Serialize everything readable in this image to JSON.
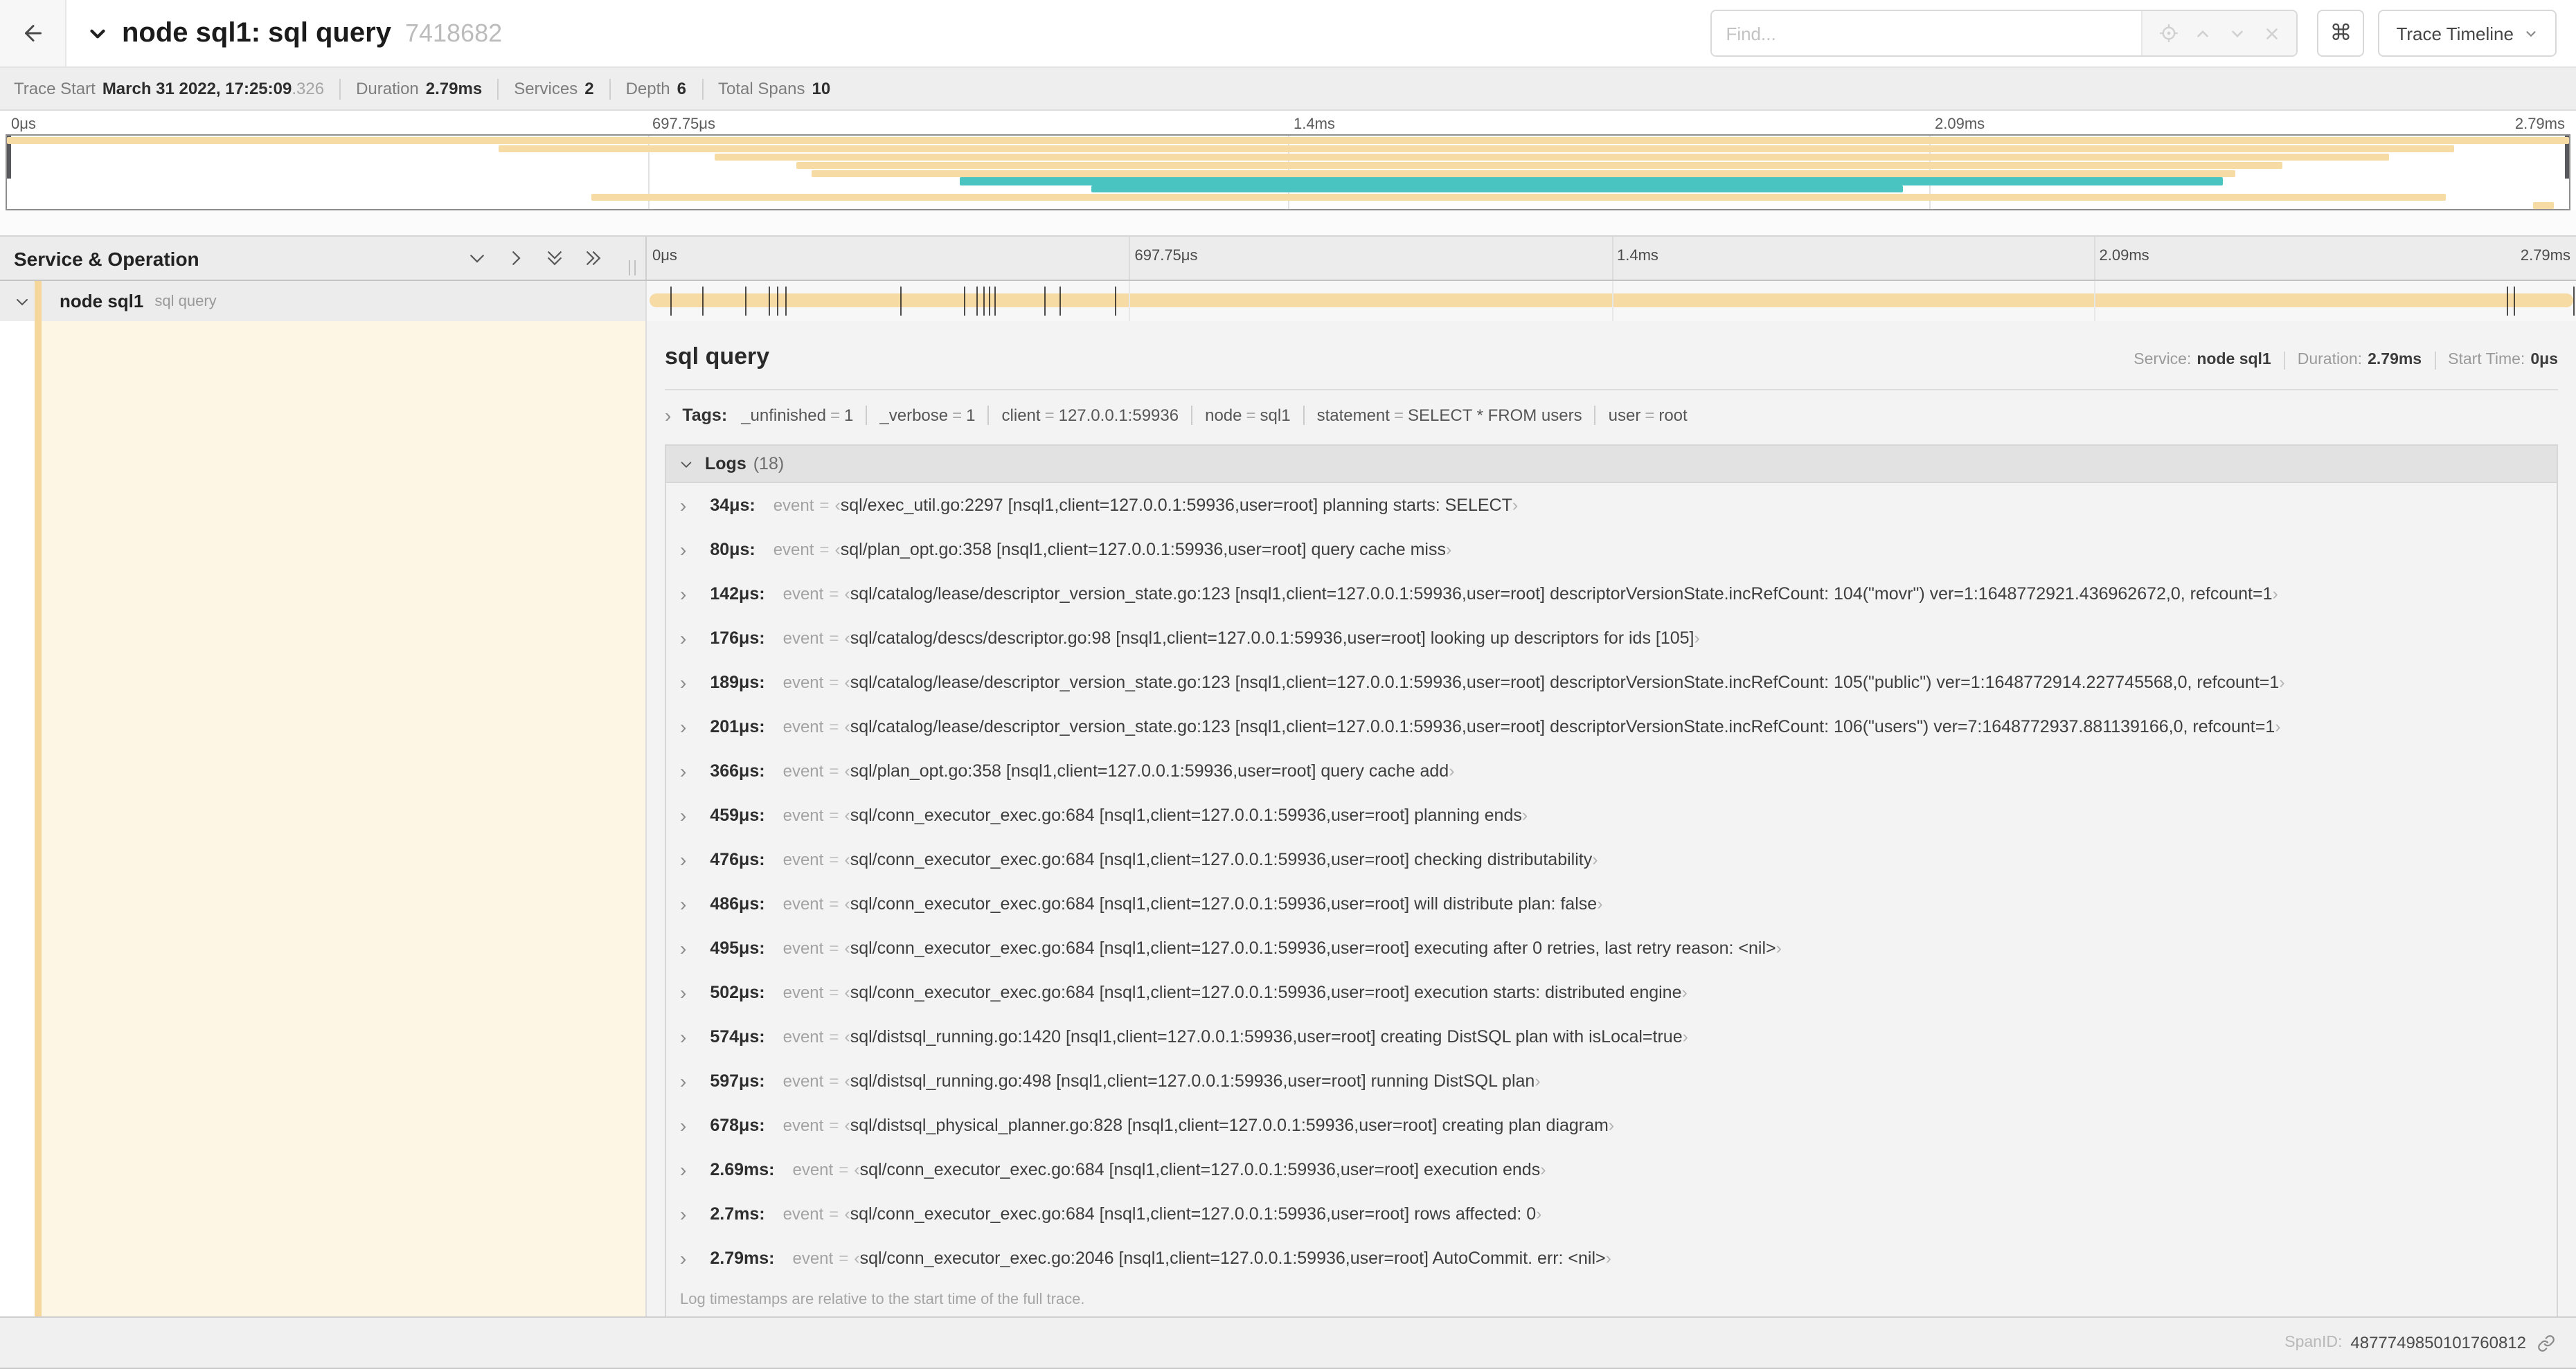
{
  "header": {
    "title": "node sql1: sql query",
    "trace_id": "7418682",
    "find_placeholder": "Find...",
    "shortcut_label": "⌘",
    "view_dropdown": "Trace Timeline"
  },
  "summary": {
    "trace_start_label": "Trace Start",
    "trace_start": "March 31 2022, 17:25:09",
    "trace_start_fraction": ".326",
    "duration_label": "Duration",
    "duration": "2.79ms",
    "services_label": "Services",
    "services": "2",
    "depth_label": "Depth",
    "depth": "6",
    "total_spans_label": "Total Spans",
    "total_spans": "10"
  },
  "timeline": {
    "service_operation_label": "Service & Operation",
    "ticks": [
      {
        "label": "0μs",
        "pct": 0
      },
      {
        "label": "697.75μs",
        "pct": 25
      },
      {
        "label": "1.4ms",
        "pct": 50
      },
      {
        "label": "2.09ms",
        "pct": 75
      },
      {
        "label": "2.79ms",
        "pct": 100
      }
    ]
  },
  "minimap": {
    "spans": [
      {
        "start": 0.0,
        "end": 1.0,
        "color": "tan"
      },
      {
        "start": 0.192,
        "end": 0.955,
        "color": "tan"
      },
      {
        "start": 0.276,
        "end": 0.93,
        "color": "tan"
      },
      {
        "start": 0.308,
        "end": 0.888,
        "color": "tan"
      },
      {
        "start": 0.314,
        "end": 0.87,
        "color": "tan"
      },
      {
        "start": 0.372,
        "end": 0.865,
        "color": "teal"
      },
      {
        "start": 0.423,
        "end": 0.74,
        "color": "teal"
      },
      {
        "start": 0.228,
        "end": 0.952,
        "color": "tan"
      },
      {
        "start": 0.986,
        "end": 0.994,
        "color": "tan"
      }
    ]
  },
  "row": {
    "service": "node sql1",
    "operation": "sql query",
    "log_marker_positions_pct": [
      1.22,
      2.87,
      5.09,
      6.31,
      6.77,
      7.2,
      13.12,
      16.45,
      17.06,
      17.42,
      17.74,
      18.0,
      20.57,
      21.4,
      24.3,
      96.42,
      96.77,
      99.85
    ]
  },
  "detail": {
    "operation": "sql query",
    "service_label": "Service:",
    "service": "node sql1",
    "duration_label": "Duration:",
    "duration": "2.79ms",
    "start_label": "Start Time:",
    "start": "0μs",
    "tags_label": "Tags:",
    "tags": [
      {
        "key": "_unfinished",
        "value": "1"
      },
      {
        "key": "_verbose",
        "value": "1"
      },
      {
        "key": "client",
        "value": "127.0.0.1:59936"
      },
      {
        "key": "node",
        "value": "sql1"
      },
      {
        "key": "statement",
        "value": "SELECT * FROM users"
      },
      {
        "key": "user",
        "value": "root"
      }
    ],
    "logs_label": "Logs",
    "logs_count": "(18)",
    "event_label": "event",
    "logs": [
      {
        "time": "34μs:",
        "message": "sql/exec_util.go:2297 [nsql1,client=127.0.0.1:59936,user=root] planning starts: SELECT"
      },
      {
        "time": "80μs:",
        "message": "sql/plan_opt.go:358 [nsql1,client=127.0.0.1:59936,user=root] query cache miss"
      },
      {
        "time": "142μs:",
        "message": "sql/catalog/lease/descriptor_version_state.go:123 [nsql1,client=127.0.0.1:59936,user=root] descriptorVersionState.incRefCount: 104(\"movr\") ver=1:1648772921.436962672,0, refcount=1"
      },
      {
        "time": "176μs:",
        "message": "sql/catalog/descs/descriptor.go:98 [nsql1,client=127.0.0.1:59936,user=root] looking up descriptors for ids [105]"
      },
      {
        "time": "189μs:",
        "message": "sql/catalog/lease/descriptor_version_state.go:123 [nsql1,client=127.0.0.1:59936,user=root] descriptorVersionState.incRefCount: 105(\"public\") ver=1:1648772914.227745568,0, refcount=1"
      },
      {
        "time": "201μs:",
        "message": "sql/catalog/lease/descriptor_version_state.go:123 [nsql1,client=127.0.0.1:59936,user=root] descriptorVersionState.incRefCount: 106(\"users\") ver=7:1648772937.881139166,0, refcount=1"
      },
      {
        "time": "366μs:",
        "message": "sql/plan_opt.go:358 [nsql1,client=127.0.0.1:59936,user=root] query cache add"
      },
      {
        "time": "459μs:",
        "message": "sql/conn_executor_exec.go:684 [nsql1,client=127.0.0.1:59936,user=root] planning ends"
      },
      {
        "time": "476μs:",
        "message": "sql/conn_executor_exec.go:684 [nsql1,client=127.0.0.1:59936,user=root] checking distributability"
      },
      {
        "time": "486μs:",
        "message": "sql/conn_executor_exec.go:684 [nsql1,client=127.0.0.1:59936,user=root] will distribute plan: false"
      },
      {
        "time": "495μs:",
        "message": "sql/conn_executor_exec.go:684 [nsql1,client=127.0.0.1:59936,user=root] executing after 0 retries, last retry reason: <nil>"
      },
      {
        "time": "502μs:",
        "message": "sql/conn_executor_exec.go:684 [nsql1,client=127.0.0.1:59936,user=root] execution starts: distributed engine"
      },
      {
        "time": "574μs:",
        "message": "sql/distsql_running.go:1420 [nsql1,client=127.0.0.1:59936,user=root] creating DistSQL plan with isLocal=true"
      },
      {
        "time": "597μs:",
        "message": "sql/distsql_running.go:498 [nsql1,client=127.0.0.1:59936,user=root] running DistSQL plan"
      },
      {
        "time": "678μs:",
        "message": "sql/distsql_physical_planner.go:828 [nsql1,client=127.0.0.1:59936,user=root] creating plan diagram"
      },
      {
        "time": "2.69ms:",
        "message": "sql/conn_executor_exec.go:684 [nsql1,client=127.0.0.1:59936,user=root] execution ends"
      },
      {
        "time": "2.7ms:",
        "message": "sql/conn_executor_exec.go:684 [nsql1,client=127.0.0.1:59936,user=root] rows affected: 0"
      },
      {
        "time": "2.79ms:",
        "message": "sql/conn_executor_exec.go:2046 [nsql1,client=127.0.0.1:59936,user=root] AutoCommit. err: <nil>"
      }
    ],
    "footnote": "Log timestamps are relative to the start time of the full trace.",
    "span_id_label": "SpanID:",
    "span_id": "4877749850101760812"
  },
  "colors": {
    "tan": "#f6dba4",
    "teal": "#49c4c1",
    "accent": "#f5d79c",
    "cream": "#fdf6e4"
  }
}
